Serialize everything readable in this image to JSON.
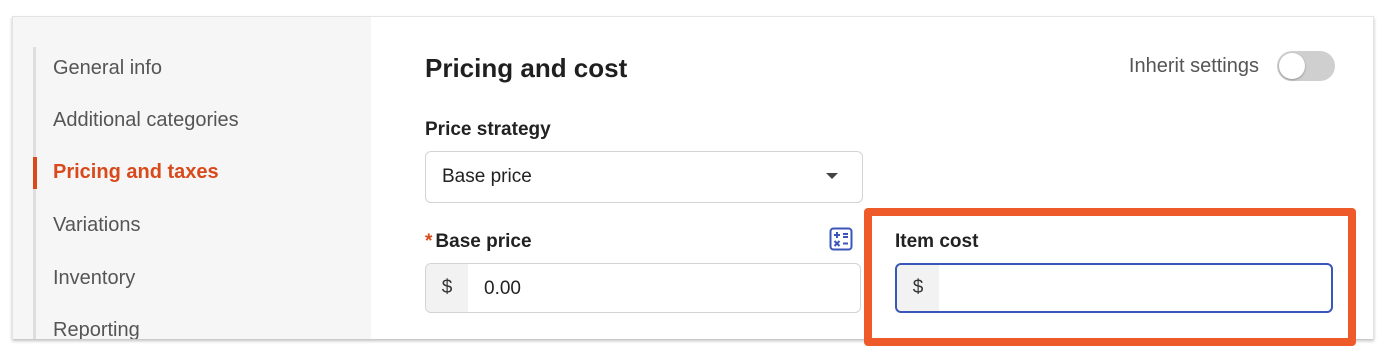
{
  "sidebar": {
    "items": [
      {
        "label": "General info",
        "active": false
      },
      {
        "label": "Additional categories",
        "active": false
      },
      {
        "label": "Pricing and taxes",
        "active": true
      },
      {
        "label": "Variations",
        "active": false
      },
      {
        "label": "Inventory",
        "active": false
      },
      {
        "label": "Reporting",
        "active": false
      }
    ]
  },
  "section": {
    "title": "Pricing and cost",
    "inherit_label": "Inherit settings",
    "inherit_enabled": false
  },
  "price_strategy": {
    "label": "Price strategy",
    "selected": "Base price"
  },
  "base_price": {
    "required_marker": "*",
    "label": "Base price",
    "prefix": "$",
    "value": "0.00",
    "calculator_icon": "calculator-icon"
  },
  "item_cost": {
    "label": "Item cost",
    "prefix": "$",
    "value": ""
  },
  "colors": {
    "accent": "#d84a1b",
    "highlight": "#ef5a2b",
    "focus_border": "#3a56b8"
  }
}
